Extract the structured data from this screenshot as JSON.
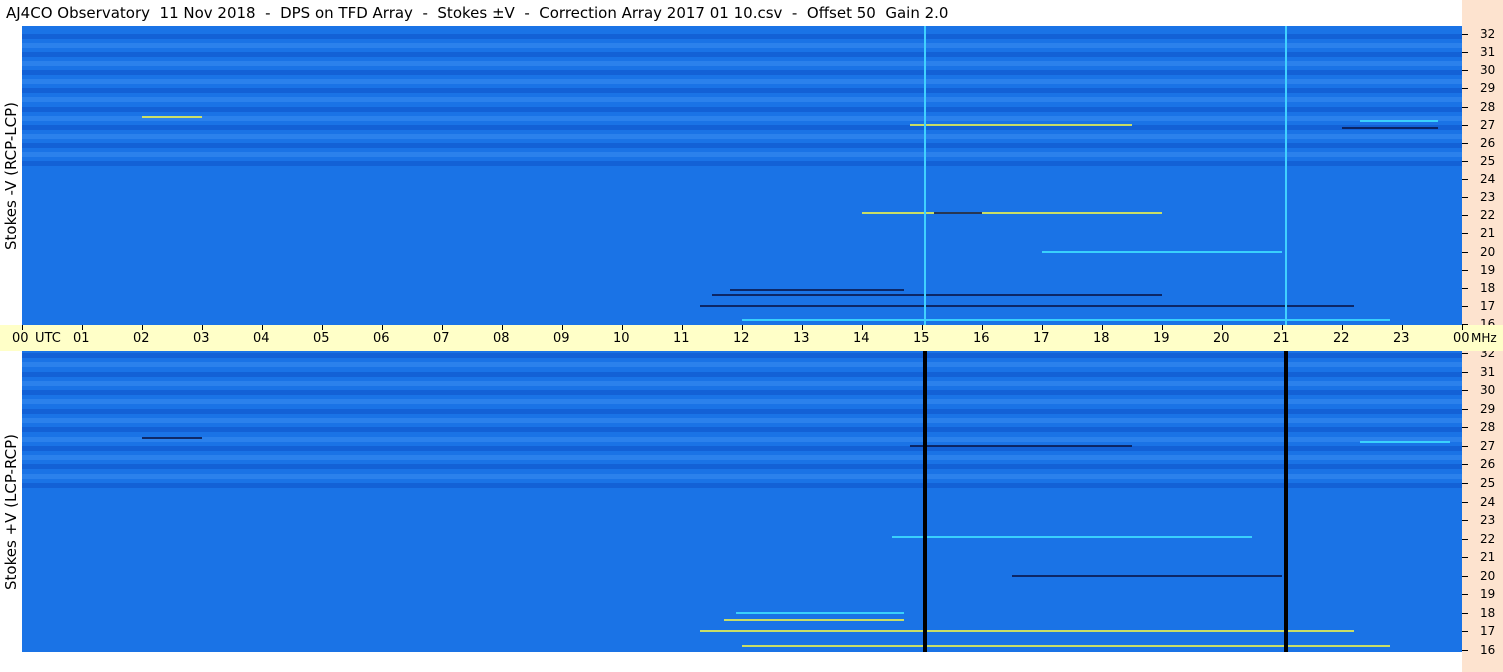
{
  "title": "AJ4CO Observatory  11 Nov 2018  -  DPS on TFD Array  -  Stokes ±V  -  Correction Array 2017 01 10.csv  -  Offset 50  Gain 2.0",
  "colors": {
    "panel_base": "#1a73e6",
    "dark_band": "#0f52c8",
    "light_band": "#3a8cf0",
    "time_bar": "#ffffc8",
    "freq_column": "#fde3cf",
    "bright_line": "#40d0ff",
    "dark_line": "#000000",
    "burst_yellow": "#e8f050",
    "burst_cyan": "#40e0ff"
  },
  "chart_data": [
    {
      "type": "heatmap",
      "name": "Stokes -V (RCP-LCP)",
      "ylabel": "Stokes -V (RCP-LCP)",
      "x_unit": "UTC",
      "x_ticks": [
        "00",
        "01",
        "02",
        "03",
        "04",
        "05",
        "06",
        "07",
        "08",
        "09",
        "10",
        "11",
        "12",
        "13",
        "14",
        "15",
        "16",
        "17",
        "18",
        "19",
        "20",
        "21",
        "22",
        "23",
        "00"
      ],
      "y_unit": "MHz",
      "y_ticks": [
        16,
        17,
        18,
        19,
        20,
        21,
        22,
        23,
        24,
        25,
        26,
        27,
        28,
        29,
        30,
        31,
        32
      ],
      "ylim": [
        16,
        32
      ],
      "xlim_hours": [
        0,
        24
      ],
      "vertical_markers_hours": [
        15.05,
        21.07
      ],
      "marker_color": "bright",
      "features": [
        {
          "t0": 11.3,
          "t1": 22.2,
          "f": 17.0,
          "kind": "dark"
        },
        {
          "t0": 11.5,
          "t1": 19.0,
          "f": 17.6,
          "kind": "dark"
        },
        {
          "t0": 11.8,
          "t1": 14.7,
          "f": 17.9,
          "kind": "dark"
        },
        {
          "t0": 12.0,
          "t1": 22.8,
          "f": 16.2,
          "kind": "cyan"
        },
        {
          "t0": 14.0,
          "t1": 19.0,
          "f": 22.1,
          "kind": "yellow"
        },
        {
          "t0": 15.2,
          "t1": 16.0,
          "f": 22.1,
          "kind": "dark"
        },
        {
          "t0": 17.0,
          "t1": 21.0,
          "f": 20.0,
          "kind": "cyan"
        },
        {
          "t0": 14.8,
          "t1": 18.5,
          "f": 27.0,
          "kind": "yellow"
        },
        {
          "t0": 22.3,
          "t1": 23.6,
          "f": 27.2,
          "kind": "cyan"
        },
        {
          "t0": 22.0,
          "t1": 23.6,
          "f": 26.8,
          "kind": "dark"
        },
        {
          "t0": 2.0,
          "t1": 3.0,
          "f": 27.4,
          "kind": "yellow"
        }
      ]
    },
    {
      "type": "heatmap",
      "name": "Stokes +V (LCP-RCP)",
      "ylabel": "Stokes +V (LCP-RCP)",
      "x_unit": "UTC",
      "x_ticks": [
        "00",
        "01",
        "02",
        "03",
        "04",
        "05",
        "06",
        "07",
        "08",
        "09",
        "10",
        "11",
        "12",
        "13",
        "14",
        "15",
        "16",
        "17",
        "18",
        "19",
        "20",
        "21",
        "22",
        "23",
        "00"
      ],
      "y_unit": "MHz",
      "y_ticks": [
        16,
        17,
        18,
        19,
        20,
        21,
        22,
        23,
        24,
        25,
        26,
        27,
        28,
        29,
        30,
        31,
        32
      ],
      "ylim": [
        16,
        32
      ],
      "xlim_hours": [
        0,
        24
      ],
      "vertical_markers_hours": [
        15.05,
        21.07
      ],
      "marker_color": "dark",
      "features": [
        {
          "t0": 11.3,
          "t1": 22.2,
          "f": 17.0,
          "kind": "yellow"
        },
        {
          "t0": 11.7,
          "t1": 14.7,
          "f": 17.6,
          "kind": "yellow"
        },
        {
          "t0": 11.9,
          "t1": 14.7,
          "f": 18.0,
          "kind": "cyan"
        },
        {
          "t0": 12.0,
          "t1": 22.8,
          "f": 16.2,
          "kind": "yellow"
        },
        {
          "t0": 16.5,
          "t1": 21.0,
          "f": 20.0,
          "kind": "dark"
        },
        {
          "t0": 14.5,
          "t1": 20.5,
          "f": 22.1,
          "kind": "cyan"
        },
        {
          "t0": 14.8,
          "t1": 18.5,
          "f": 27.0,
          "kind": "dark"
        },
        {
          "t0": 22.3,
          "t1": 23.8,
          "f": 27.2,
          "kind": "cyan"
        },
        {
          "t0": 2.0,
          "t1": 3.0,
          "f": 27.4,
          "kind": "dark"
        }
      ]
    }
  ]
}
